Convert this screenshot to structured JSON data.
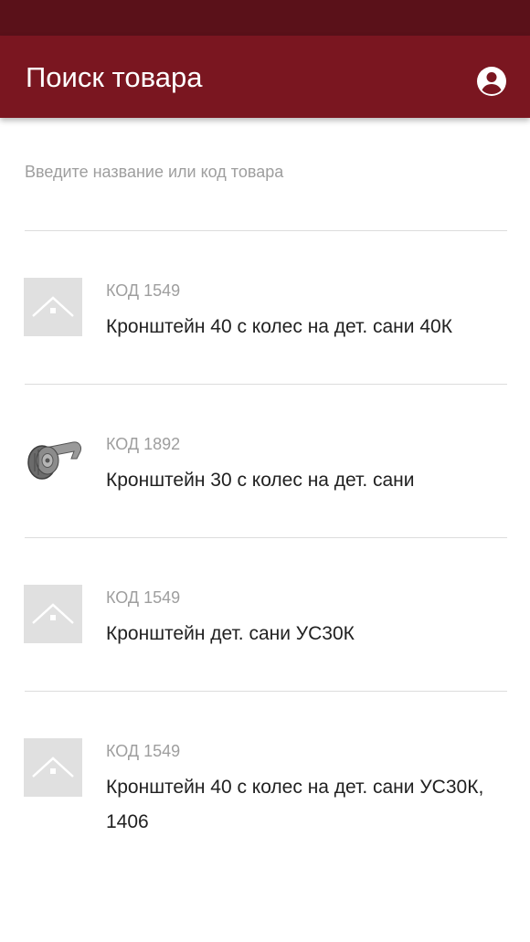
{
  "app_bar": {
    "title": "Поиск товара",
    "account_icon": "account-circle-icon"
  },
  "search": {
    "placeholder": "Введите название или код товара",
    "value": ""
  },
  "products": [
    {
      "code_label": "КОД",
      "code": "1549",
      "name": "Кронштейн 40 с колес на дет. сани 40К",
      "image": "placeholder-image-icon"
    },
    {
      "code_label": "КОД",
      "code": "1892",
      "name": "Кронштейн 30 с колес на дет. сани",
      "image": "bracket-wheel-photo"
    },
    {
      "code_label": "КОД",
      "code": "1549",
      "name": "Кронштейн дет. сани УС30К",
      "image": "placeholder-image-icon"
    },
    {
      "code_label": "КОД",
      "code": "1549",
      "name": "Кронштейн 40 с колес на дет. сани УС30К, 1406",
      "image": "placeholder-image-icon"
    }
  ],
  "colors": {
    "status_bar": "#5a1119",
    "app_bar": "#7a1620",
    "placeholder_bg": "#e0e0e0",
    "divider": "#dcdcdc",
    "secondary_text": "#9e9e9e",
    "primary_text": "#212121"
  }
}
